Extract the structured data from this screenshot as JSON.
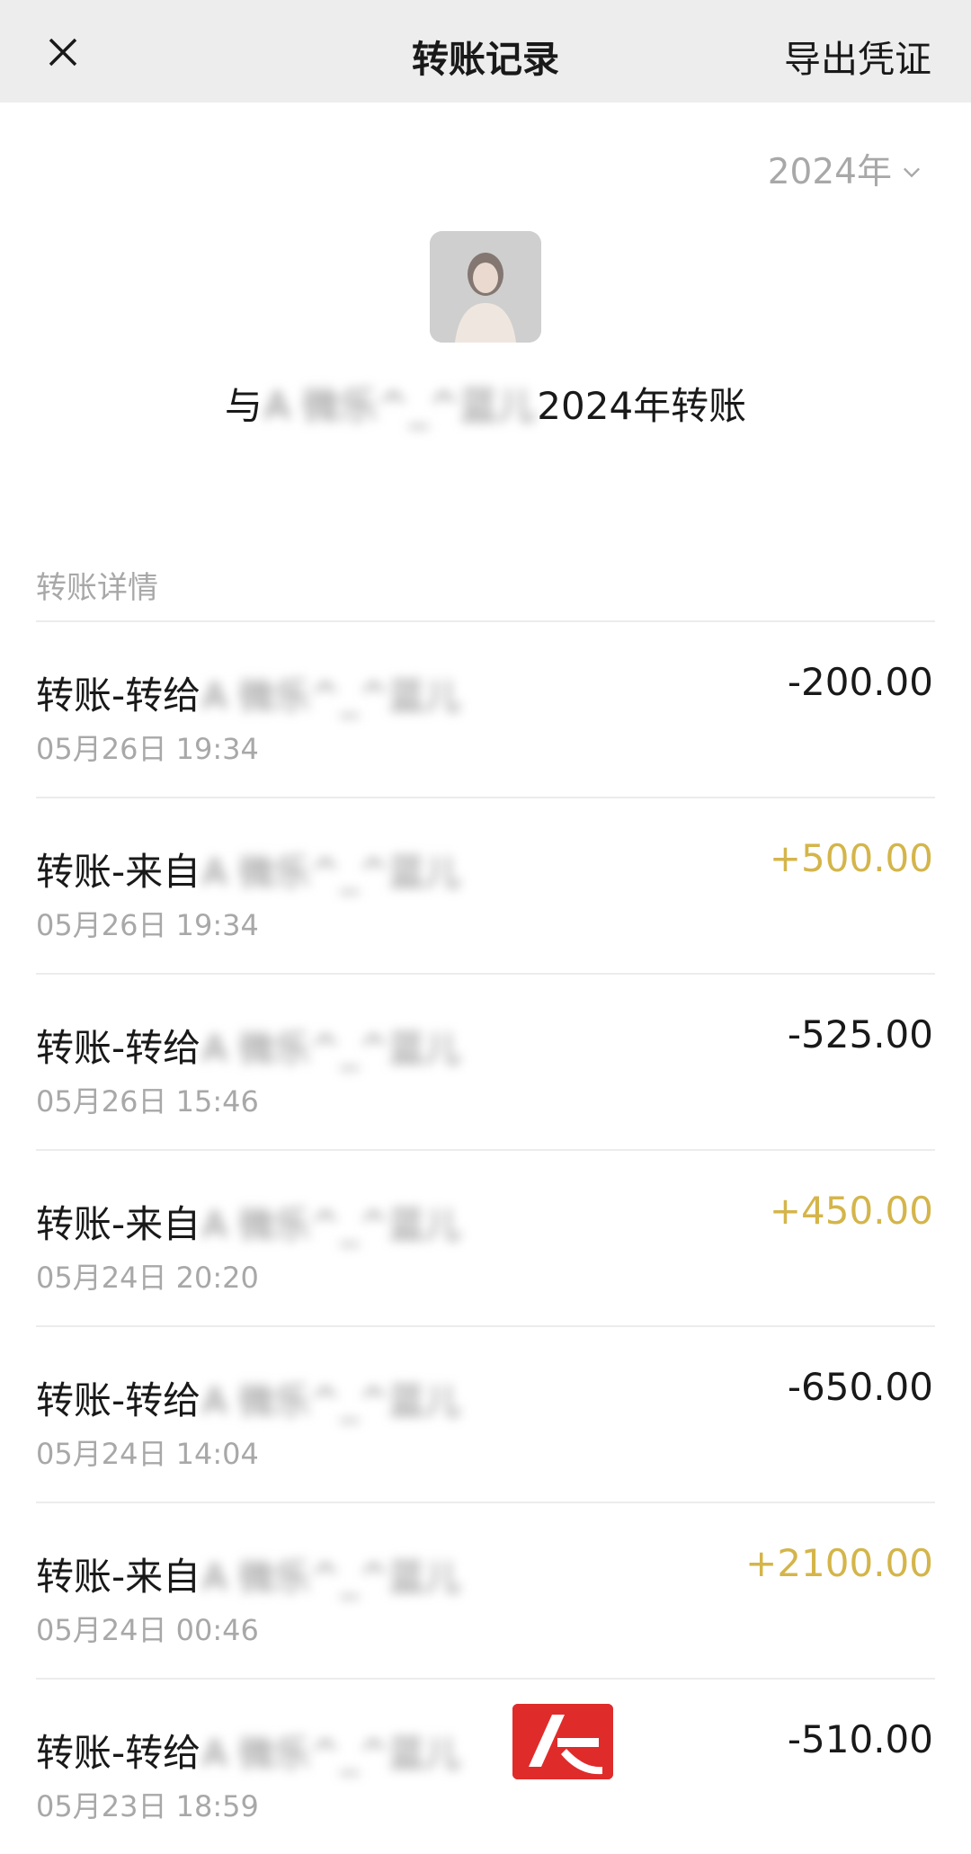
{
  "navbar": {
    "close_icon": "close-icon",
    "title": "转账记录",
    "export_label": "导出凭证"
  },
  "year_picker": {
    "value": "2024年",
    "icon": "chevron-down-icon"
  },
  "peer": {
    "prefix": "与",
    "name": "A 微乐^_^蓝儿",
    "suffix": "2024年转账"
  },
  "section_label": "转账详情",
  "records": [
    {
      "title": "转账-转给",
      "name": "A 微乐^_^蓝儿",
      "time": "05月26日 19:34",
      "amount": "-200.00",
      "direction": "out"
    },
    {
      "title": "转账-来自",
      "name": "A 微乐^_^蓝儿",
      "time": "05月26日 19:34",
      "amount": "+500.00",
      "direction": "in"
    },
    {
      "title": "转账-转给",
      "name": "A 微乐^_^蓝儿",
      "time": "05月26日 15:46",
      "amount": "-525.00",
      "direction": "out"
    },
    {
      "title": "转账-来自",
      "name": "A 微乐^_^蓝儿",
      "time": "05月24日 20:20",
      "amount": "+450.00",
      "direction": "in"
    },
    {
      "title": "转账-转给",
      "name": "A 微乐^_^蓝儿",
      "time": "05月24日 14:04",
      "amount": "-650.00",
      "direction": "out"
    },
    {
      "title": "转账-来自",
      "name": "A 微乐^_^蓝儿",
      "time": "05月24日 00:46",
      "amount": "+2100.00",
      "direction": "in"
    },
    {
      "title": "转账-转给",
      "name": "A 微乐^_^蓝儿",
      "time": "05月23日 18:59",
      "amount": "-510.00",
      "direction": "out"
    }
  ],
  "colors": {
    "navbar_bg": "#ededed",
    "income": "#d4b54a",
    "expense": "#191919",
    "muted": "#a8a8a8",
    "watermark_logo": "#e02b2b"
  }
}
